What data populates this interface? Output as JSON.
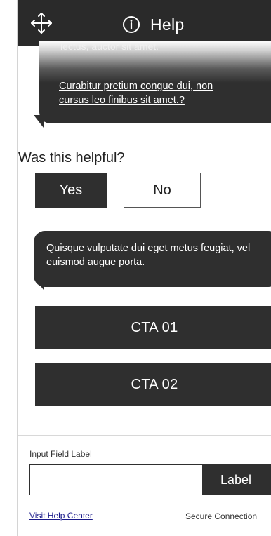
{
  "header": {
    "move_icon": "move-arrows-icon",
    "info_icon": "info-circle-icon",
    "title": "Help"
  },
  "bubble1": {
    "cut_text": "lectus, auctor sit amet.",
    "link_text": "Curabitur pretium congue dui, non cursus leo finibus sit amet.?"
  },
  "feedback": {
    "question": "Was this helpful?",
    "yes_label": "Yes",
    "no_label": "No"
  },
  "bubble2": {
    "text": "Quisque vulputate dui eget metus feugiat, vel euismod augue porta."
  },
  "cta": {
    "cta1_label": "CTA 01",
    "cta2_label": "CTA 02"
  },
  "input": {
    "field_label": "Input Field Label",
    "value": "",
    "button_label": "Label"
  },
  "footer": {
    "help_center_link": "Visit Help Center",
    "secure_text": "Secure Connection"
  },
  "colors": {
    "dark": "#2f2f2f",
    "header": "#2a2a2a",
    "link": "#1a1a8a"
  }
}
